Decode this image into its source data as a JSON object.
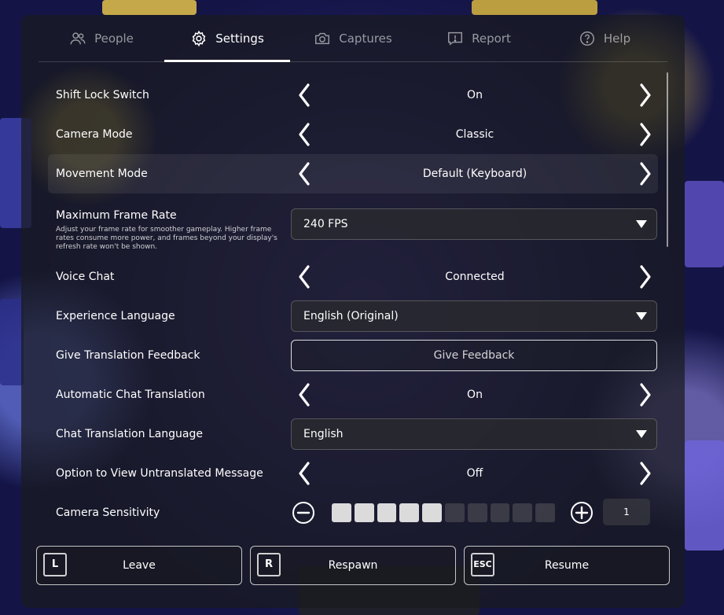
{
  "tabs": [
    {
      "label": "People",
      "icon": "people-icon",
      "active": false
    },
    {
      "label": "Settings",
      "icon": "gear-icon",
      "active": true
    },
    {
      "label": "Captures",
      "icon": "camera-icon",
      "active": false
    },
    {
      "label": "Report",
      "icon": "report-icon",
      "active": false
    },
    {
      "label": "Help",
      "icon": "help-icon",
      "active": false
    }
  ],
  "settings": {
    "shift_lock": {
      "label": "Shift Lock Switch",
      "value": "On"
    },
    "camera_mode": {
      "label": "Camera Mode",
      "value": "Classic"
    },
    "movement_mode": {
      "label": "Movement Mode",
      "value": "Default (Keyboard)"
    },
    "frame_rate": {
      "label": "Maximum Frame Rate",
      "description": "Adjust your frame rate for smoother gameplay. Higher frame rates consume more power, and frames beyond your display's refresh rate won't be shown.",
      "value": "240 FPS"
    },
    "voice_chat": {
      "label": "Voice Chat",
      "value": "Connected"
    },
    "experience_language": {
      "label": "Experience Language",
      "value": "English (Original)"
    },
    "translation_feedback": {
      "label": "Give Translation Feedback",
      "button": "Give Feedback"
    },
    "auto_chat_translation": {
      "label": "Automatic Chat Translation",
      "value": "On"
    },
    "chat_translation_language": {
      "label": "Chat Translation Language",
      "value": "English"
    },
    "untranslated_message": {
      "label": "Option to View Untranslated Message",
      "value": "Off"
    },
    "camera_sensitivity": {
      "label": "Camera Sensitivity",
      "value": "1",
      "filled_segments": 5,
      "total_segments": 10
    }
  },
  "bottom_buttons": [
    {
      "key": "L",
      "label": "Leave"
    },
    {
      "key": "R",
      "label": "Respawn"
    },
    {
      "key": "ESC",
      "label": "Resume"
    }
  ],
  "colors": {
    "panel": "#191b1e",
    "text": "#ffffff",
    "inactive_tab": "#8c8c8c"
  }
}
